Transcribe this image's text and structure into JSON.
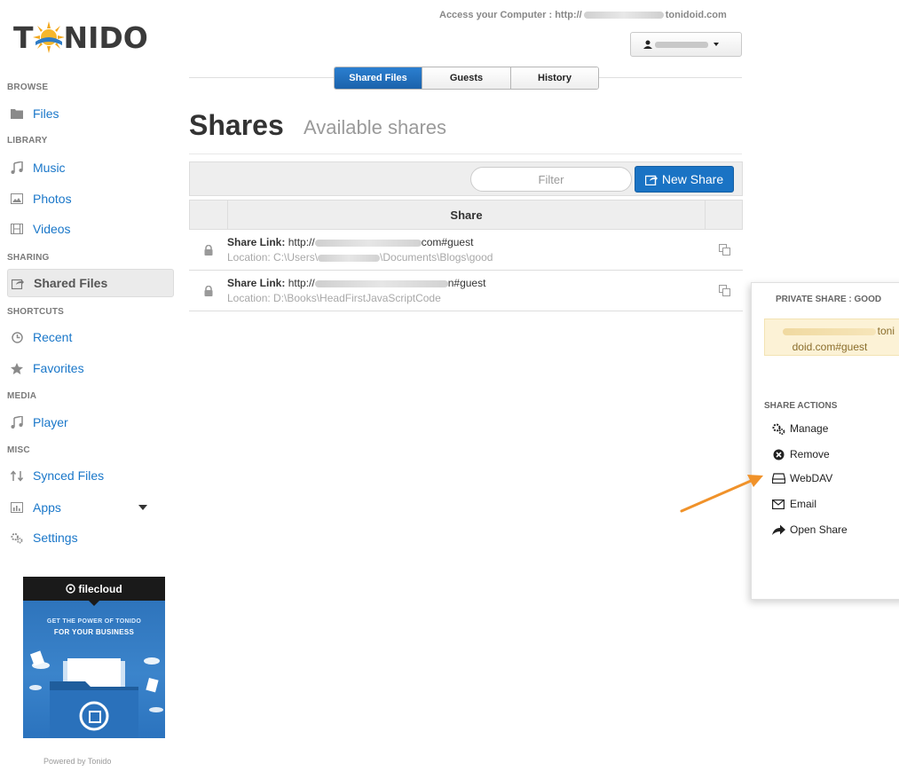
{
  "brand": {
    "logo_before": "T",
    "logo_after": "NIDO"
  },
  "topbar": {
    "access_label": "Access your Computer : http://",
    "access_domain": "tonidoid.com",
    "user_menu": ""
  },
  "tabs": [
    {
      "label": "Shared Files",
      "active": true
    },
    {
      "label": "Guests",
      "active": false
    },
    {
      "label": "History",
      "active": false
    }
  ],
  "sidebar": {
    "sections": {
      "browse": "BROWSE",
      "library": "LIBRARY",
      "sharing": "SHARING",
      "shortcuts": "SHORTCUTS",
      "media": "MEDIA",
      "misc": "MISC"
    },
    "items": {
      "files": "Files",
      "music": "Music",
      "photos": "Photos",
      "videos": "Videos",
      "shared_files": "Shared Files",
      "recent": "Recent",
      "favorites": "Favorites",
      "player": "Player",
      "synced_files": "Synced Files",
      "apps": "Apps",
      "settings": "Settings"
    }
  },
  "promo": {
    "brand": "filecloud",
    "line1": "GET THE POWER OF TONIDO",
    "line2": "FOR YOUR BUSINESS"
  },
  "footer": {
    "powered_by": "Powered by Tonido"
  },
  "page": {
    "title": "Shares",
    "subtitle": "Available shares"
  },
  "toolbar": {
    "filter_placeholder": "Filter",
    "new_share_label": "New Share"
  },
  "table": {
    "header": "Share",
    "rows": [
      {
        "link_label": "Share Link:",
        "link_prefix": "http://",
        "link_suffix": "com#guest",
        "location_prefix": "Location: C:\\Users\\",
        "location_suffix": "\\Documents\\Blogs\\good"
      },
      {
        "link_label": "Share Link:",
        "link_prefix": "http://",
        "link_suffix": "n#guest",
        "location_prefix": "Location: D:\\Books\\HeadFirstJavaScriptCode",
        "location_suffix": ""
      }
    ]
  },
  "panel": {
    "title": "PRIVATE SHARE : GOOD",
    "link_part1": "toni",
    "link_part2": "doid.com#guest",
    "actions_title": "SHARE ACTIONS",
    "actions": {
      "manage": "Manage",
      "remove": "Remove",
      "webdav": "WebDAV",
      "email": "Email",
      "open_share": "Open Share"
    }
  },
  "colors": {
    "link_blue": "#1a77c9",
    "primary_button": "#1a73c4",
    "annotation_arrow": "#f0922a",
    "highlight_bg": "#fcf2d6"
  }
}
